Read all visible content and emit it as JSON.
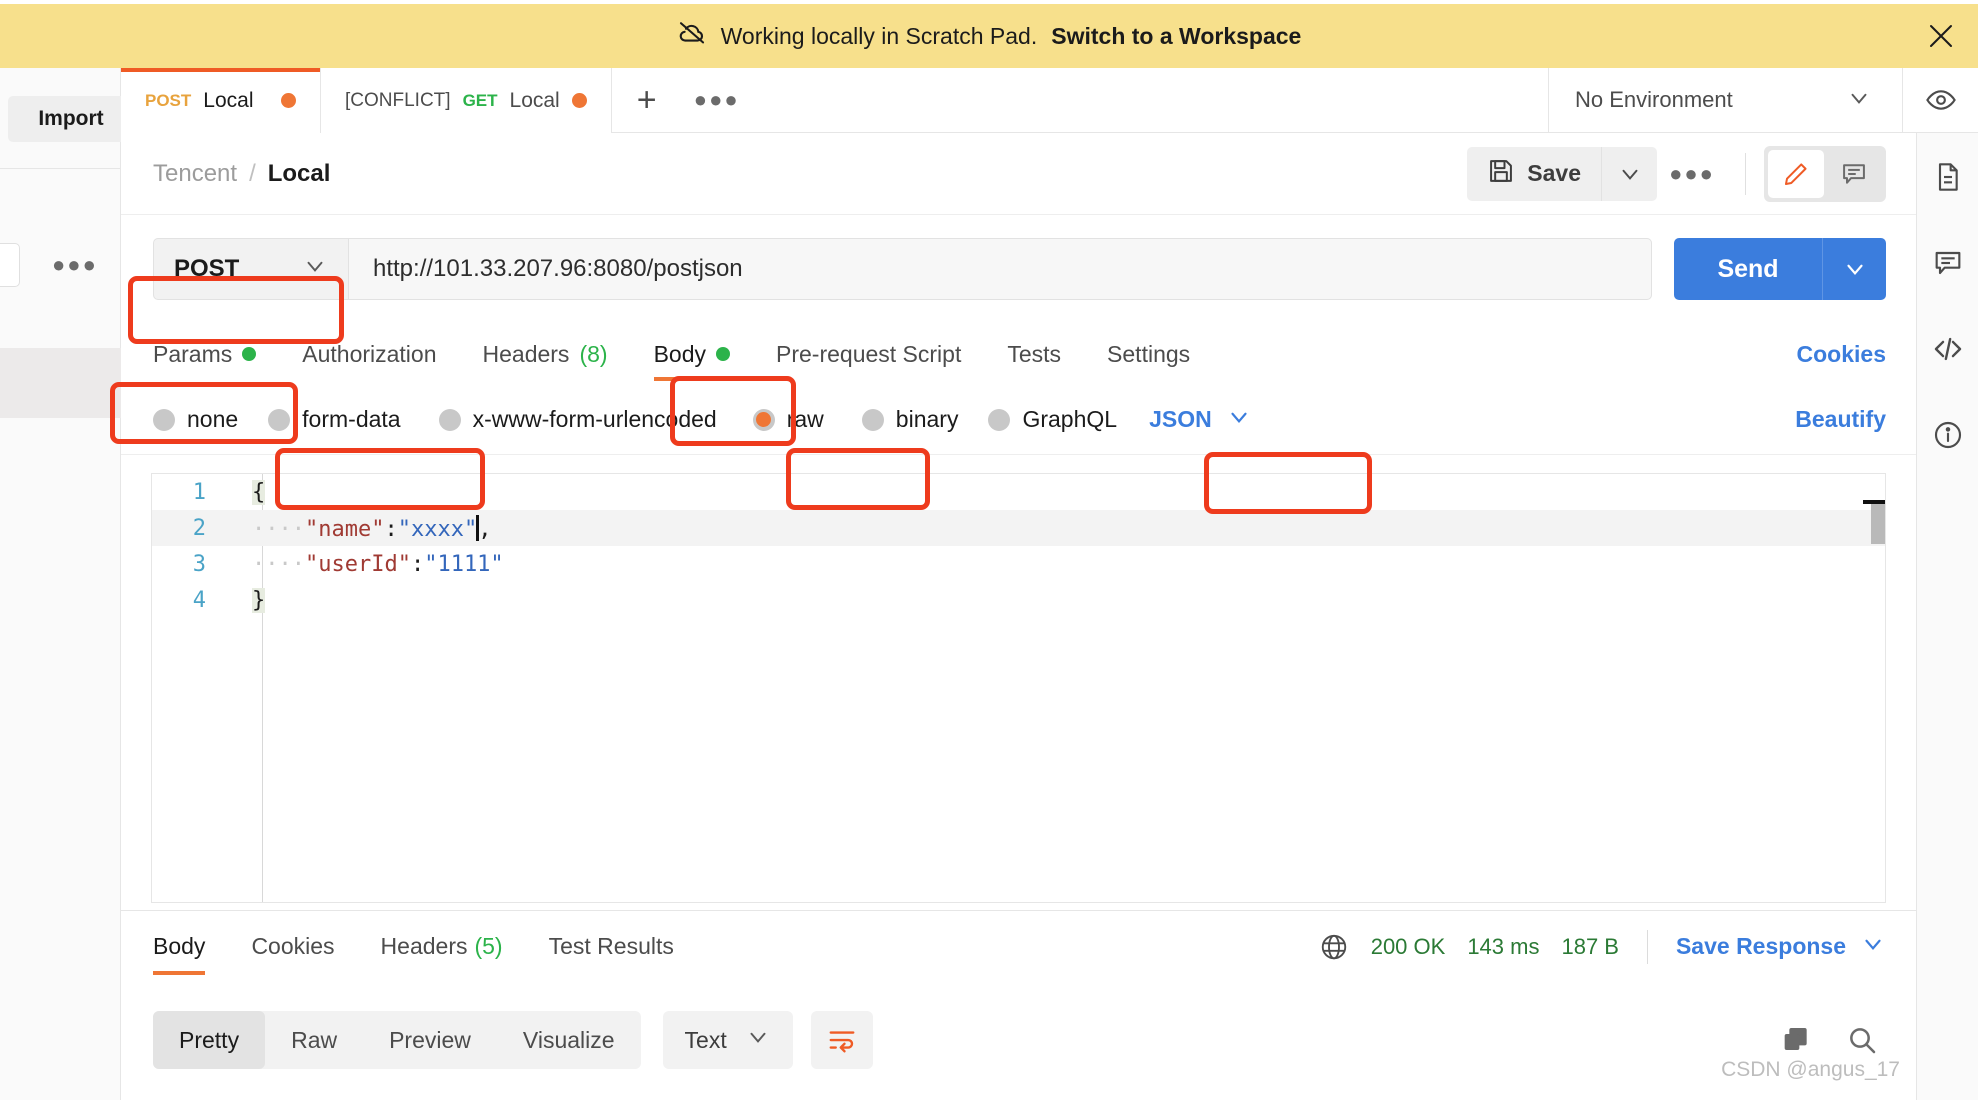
{
  "banner": {
    "icon": "cloud-off-icon",
    "text": "Working locally in Scratch Pad.",
    "action": "Switch to a Workspace",
    "close_icon": "close-icon"
  },
  "left_rail": {
    "import_label": "Import",
    "more_label": "●●●"
  },
  "tabs": [
    {
      "method": "POST",
      "conflict": "",
      "name": "Local",
      "active": true,
      "unsaved": true
    },
    {
      "method": "GET",
      "conflict": "[CONFLICT]",
      "name": "Local",
      "active": false,
      "unsaved": true
    }
  ],
  "tabbar": {
    "new_tab_icon": "plus-icon",
    "more_tabs_icon": "ellipsis-icon",
    "environment": "No Environment",
    "env_chevron_icon": "chevron-down-icon",
    "eye_icon": "eye-icon"
  },
  "breadcrumb": {
    "parent": "Tencent",
    "separator": "/",
    "current": "Local"
  },
  "toolbar": {
    "save_label": "Save",
    "save_icon": "floppy-disk-icon",
    "save_chevron_icon": "chevron-down-icon",
    "more_icon": "ellipsis-icon",
    "edit_icon": "pencil-icon",
    "comment_icon": "comment-icon"
  },
  "request": {
    "method": "POST",
    "method_chevron_icon": "chevron-down-icon",
    "url": "http://101.33.207.96:8080/postjson",
    "send_label": "Send",
    "send_chevron_icon": "chevron-down-icon"
  },
  "request_tabs": [
    {
      "label": "Params",
      "dot": true,
      "count": "",
      "active": false
    },
    {
      "label": "Authorization",
      "dot": false,
      "count": "",
      "active": false
    },
    {
      "label": "Headers",
      "dot": false,
      "count": "(8)",
      "active": false
    },
    {
      "label": "Body",
      "dot": true,
      "count": "",
      "active": true
    },
    {
      "label": "Pre-request Script",
      "dot": false,
      "count": "",
      "active": false
    },
    {
      "label": "Tests",
      "dot": false,
      "count": "",
      "active": false
    },
    {
      "label": "Settings",
      "dot": false,
      "count": "",
      "active": false
    }
  ],
  "links": {
    "cookies": "Cookies",
    "beautify": "Beautify"
  },
  "body_types": [
    {
      "label": "none",
      "checked": false
    },
    {
      "label": "form-data",
      "checked": false
    },
    {
      "label": "x-www-form-urlencoded",
      "checked": false
    },
    {
      "label": "raw",
      "checked": true
    },
    {
      "label": "binary",
      "checked": false
    },
    {
      "label": "GraphQL",
      "checked": false
    }
  ],
  "body_format": {
    "value": "JSON",
    "chevron_icon": "chevron-down-icon"
  },
  "editor": {
    "lines": [
      {
        "num": "1",
        "indent": "",
        "content": "{",
        "type": "brace"
      },
      {
        "num": "2",
        "indent": "····",
        "key": "\"name\"",
        "colon": ":",
        "value": "\"xxxx\"",
        "tail": ",",
        "type": "pair",
        "caret": true
      },
      {
        "num": "3",
        "indent": "····",
        "key": "\"userId\"",
        "colon": ":",
        "value": "\"1111\"",
        "tail": "",
        "type": "pair",
        "caret": false
      },
      {
        "num": "4",
        "indent": "",
        "content": "}",
        "type": "brace"
      }
    ]
  },
  "response_tabs": [
    {
      "label": "Body",
      "count": "",
      "active": true
    },
    {
      "label": "Cookies",
      "count": "",
      "active": false
    },
    {
      "label": "Headers",
      "count": "(5)",
      "active": false
    },
    {
      "label": "Test Results",
      "count": "",
      "active": false
    }
  ],
  "response_status": {
    "globe_icon": "globe-icon",
    "status": "200 OK",
    "time": "143 ms",
    "size": "187 B",
    "save_response": "Save Response",
    "save_response_chevron_icon": "chevron-down-icon"
  },
  "response_toolbar": {
    "views": [
      {
        "label": "Pretty",
        "active": true
      },
      {
        "label": "Raw",
        "active": false
      },
      {
        "label": "Preview",
        "active": false
      },
      {
        "label": "Visualize",
        "active": false
      }
    ],
    "format": "Text",
    "format_chevron_icon": "chevron-down-icon",
    "wrap_icon": "word-wrap-icon",
    "copy_icon": "copy-icon",
    "search_icon": "search-icon"
  },
  "right_rail_icons": [
    "document-icon",
    "comment-icon",
    "code-icon",
    "info-icon"
  ],
  "watermark": "CSDN @angus_17",
  "colors": {
    "banner_bg": "#f7e08c",
    "accent_orange": "#ef5b25",
    "link_blue": "#3b7ddd",
    "status_green": "#2b7a35",
    "annotation_red": "#ee3b1d"
  }
}
